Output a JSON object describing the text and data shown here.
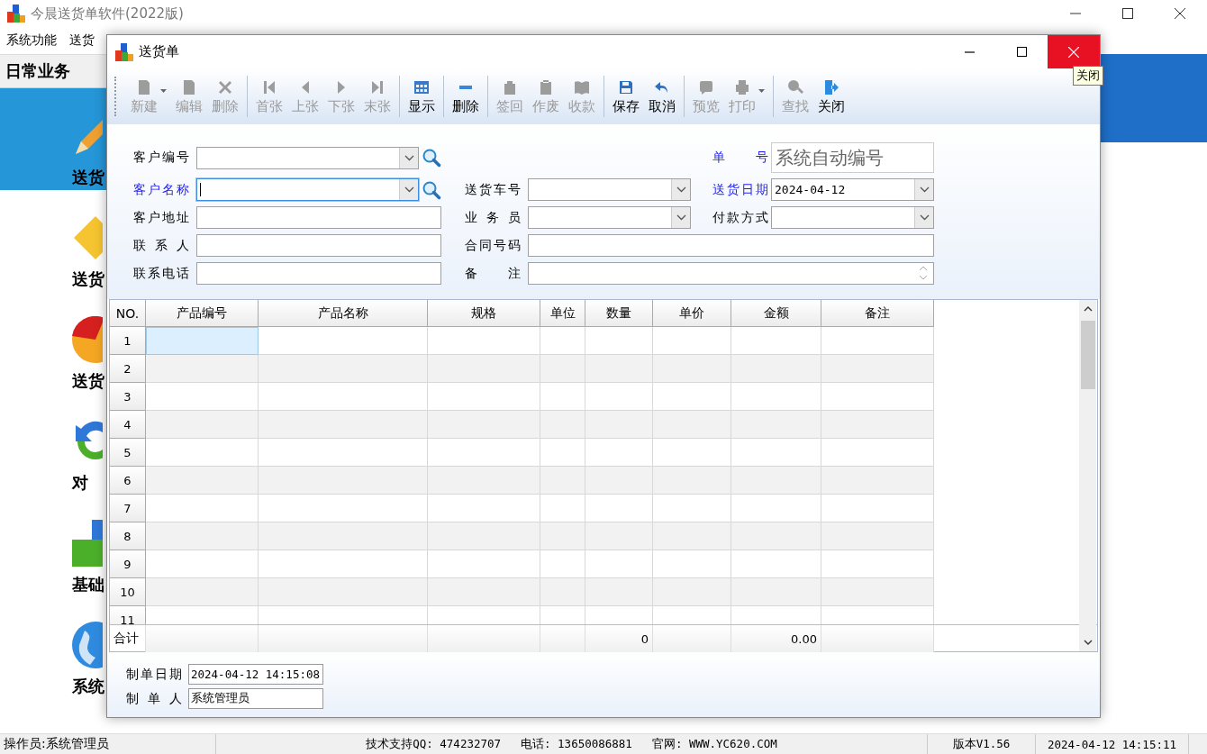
{
  "app": {
    "title": "今晨送货单软件(2022版)",
    "menu": [
      "系统功能",
      "送货"
    ],
    "nav_header": "日常业务",
    "nav_items": [
      {
        "label": "送货",
        "selected": true
      },
      {
        "label": "送货",
        "selected": false
      },
      {
        "label": "送货",
        "selected": false
      },
      {
        "label": "对",
        "selected": false
      },
      {
        "label": "基础",
        "selected": false
      },
      {
        "label": "系统",
        "selected": false
      }
    ]
  },
  "dialog": {
    "title": "送货单",
    "tooltip": "关闭",
    "toolbar": [
      [
        {
          "label": "新建",
          "disabled": true,
          "dropdown": true
        },
        {
          "label": "编辑",
          "disabled": true,
          "dropdown": false
        },
        {
          "label": "删除",
          "disabled": true,
          "dropdown": false
        }
      ],
      [
        {
          "label": "首张",
          "disabled": true,
          "dropdown": false
        },
        {
          "label": "上张",
          "disabled": true,
          "dropdown": false
        },
        {
          "label": "下张",
          "disabled": true,
          "dropdown": false
        },
        {
          "label": "末张",
          "disabled": true,
          "dropdown": false
        }
      ],
      [
        {
          "label": "显示",
          "disabled": false,
          "dropdown": false
        }
      ],
      [
        {
          "label": "删除",
          "disabled": false,
          "dropdown": false
        }
      ],
      [
        {
          "label": "签回",
          "disabled": true,
          "dropdown": false
        },
        {
          "label": "作废",
          "disabled": true,
          "dropdown": false
        },
        {
          "label": "收款",
          "disabled": true,
          "dropdown": false
        }
      ],
      [
        {
          "label": "保存",
          "disabled": false,
          "dropdown": false
        },
        {
          "label": "取消",
          "disabled": false,
          "dropdown": false
        }
      ],
      [
        {
          "label": "预览",
          "disabled": true,
          "dropdown": false
        },
        {
          "label": "打印",
          "disabled": true,
          "dropdown": true
        }
      ],
      [
        {
          "label": "查找",
          "disabled": true,
          "dropdown": false
        },
        {
          "label": "关闭",
          "disabled": false,
          "dropdown": false
        }
      ]
    ],
    "form": [
      [
        {
          "label": "客户编号",
          "kind": "combo",
          "search": true,
          "emphasized": false,
          "focused": false
        },
        {
          "label": "客户名称",
          "kind": "combo",
          "search": true,
          "emphasized": true,
          "focused": true
        },
        {
          "label": "客户地址",
          "kind": "text",
          "emphasized": false,
          "focused": false
        },
        {
          "label": "联 系 人",
          "kind": "text",
          "emphasized": false,
          "focused": false
        },
        {
          "label": "联系电话",
          "kind": "text",
          "emphasized": false,
          "focused": false
        }
      ],
      [
        {
          "label": "送货车号",
          "kind": "combo",
          "emphasized": false,
          "focused": false
        },
        {
          "label": "业 务 员",
          "kind": "combo",
          "emphasized": false,
          "focused": false
        },
        {
          "label": "合同号码",
          "kind": "text",
          "emphasized": false,
          "focused": false
        },
        {
          "label": "备 注",
          "kind": "memo",
          "emphasized": false,
          "focused": false
        }
      ],
      [
        {
          "label": "单 号",
          "kind": "display",
          "value": "系统自动编号",
          "emphasized": true,
          "focused": false
        },
        {
          "label": "送货日期",
          "kind": "combo",
          "value": "2024-04-12",
          "emphasized": true,
          "focused": false
        },
        {
          "label": "付款方式",
          "kind": "combo",
          "emphasized": false,
          "focused": false
        }
      ]
    ],
    "grid": {
      "columns": [
        "NO.",
        "产品编号",
        "产品名称",
        "规格",
        "单位",
        "数量",
        "单价",
        "金额",
        "备注"
      ],
      "rows": [
        {
          "no": "1",
          "selected": true
        },
        {
          "no": "2",
          "selected": false
        },
        {
          "no": "3",
          "selected": false
        },
        {
          "no": "4",
          "selected": false
        },
        {
          "no": "5",
          "selected": false
        },
        {
          "no": "6",
          "selected": false
        },
        {
          "no": "7",
          "selected": false
        },
        {
          "no": "8",
          "selected": false
        },
        {
          "no": "9",
          "selected": false
        },
        {
          "no": "10",
          "selected": false
        },
        {
          "no": "11",
          "selected": false
        }
      ],
      "totals": {
        "label": "合计",
        "quantity": "0",
        "amount": "0.00"
      }
    },
    "footer": [
      {
        "label": "制单日期",
        "value": "2024-04-12 14:15:08"
      },
      {
        "label": "制 单 人",
        "value": "系统管理员"
      }
    ]
  },
  "status_bar": {
    "operator": "操作员:系统管理员",
    "support": [
      "技术支持QQ: 474232707",
      "电话: 13650086881",
      "官网: WWW.YC620.COM"
    ],
    "version": "版本V1.56",
    "datetime": "2024-04-12 14:15:11"
  }
}
